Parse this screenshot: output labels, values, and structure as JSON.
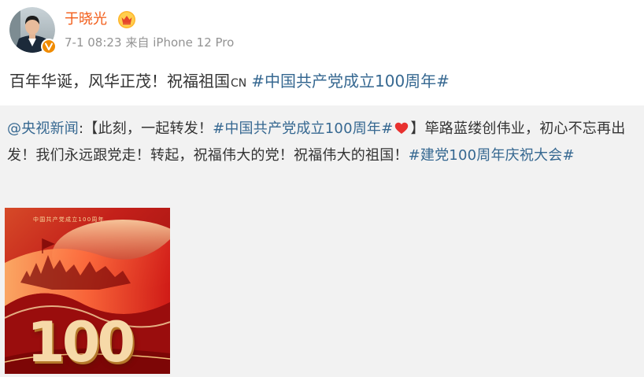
{
  "header": {
    "username": "于晓光",
    "crown_icon": "crown-icon",
    "verified_icon": "verified-v-icon",
    "timestamp": "7-1 08:23",
    "source": "来自 iPhone 12 Pro"
  },
  "post": {
    "text": "百年华诞，风华正茂！祝福祖国",
    "flag_mark": "CN",
    "topic": "#中国共产党成立100周年#"
  },
  "retweet": {
    "mention": "@央视新闻",
    "colon": ":",
    "part1": "【此刻，一起转发！",
    "topic1": "#中国共产党成立100周年#",
    "heart_icon": "red-heart-icon",
    "part2": "】筚路蓝缕创伟业，初心不忘再出发！我们永远跟党走！转起，祝福伟大的党！祝福伟大的祖国！",
    "topic2": "#建党100周年庆祝大会#",
    "image": {
      "caption": "中国共产党成立100周年",
      "number": "100"
    }
  },
  "colors": {
    "username": "#f25c18",
    "link": "#366891",
    "meta": "#939393",
    "retweet_bg": "#f2f2f2",
    "badge": "#f08b00"
  }
}
